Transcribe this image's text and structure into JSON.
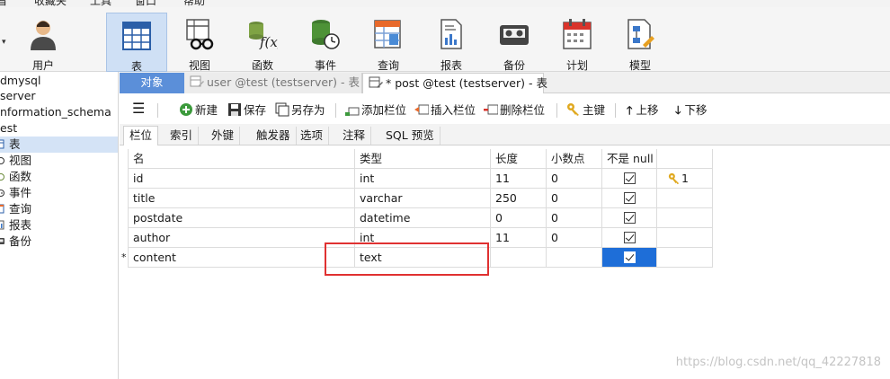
{
  "menu": [
    "看",
    "收藏夹",
    "工具",
    "窗口",
    "帮助"
  ],
  "ribbon": {
    "buttons": [
      {
        "label": "用户"
      },
      {
        "label": "表"
      },
      {
        "label": "视图"
      },
      {
        "label": "函数"
      },
      {
        "label": "事件"
      },
      {
        "label": "查询"
      },
      {
        "label": "报表"
      },
      {
        "label": "备份"
      },
      {
        "label": "计划"
      },
      {
        "label": "模型"
      }
    ],
    "active": "表"
  },
  "tree": {
    "nodes": [
      {
        "label": "dmysql"
      },
      {
        "label": "server"
      },
      {
        "label": "nformation_schema"
      },
      {
        "label": "est"
      },
      {
        "label": "表"
      },
      {
        "label": "视图"
      },
      {
        "label": "函数"
      },
      {
        "label": "事件"
      },
      {
        "label": "查询"
      },
      {
        "label": "报表"
      },
      {
        "label": "备份"
      }
    ]
  },
  "tabs": {
    "objects": "对象",
    "user_tab": "user @test (testserver) - 表",
    "post_tab": "* post @test (testserver) - 表"
  },
  "toolbar": {
    "new": "新建",
    "save": "保存",
    "save_as": "另存为",
    "add_field": "添加栏位",
    "insert_field": "插入栏位",
    "delete_field": "删除栏位",
    "primary_key": "主键",
    "move_up": "上移",
    "move_down": "下移"
  },
  "subtabs": [
    "栏位",
    "索引",
    "外键",
    "触发器",
    "选项",
    "注释",
    "SQL 预览"
  ],
  "grid": {
    "headers": {
      "name": "名",
      "type": "类型",
      "length": "长度",
      "decimals": "小数点",
      "not_null": "不是 null"
    },
    "rows": [
      {
        "indicator": "",
        "name": "id",
        "type": "int",
        "length": "11",
        "decimals": "0",
        "not_null": true,
        "key": "1"
      },
      {
        "indicator": "",
        "name": "title",
        "type": "varchar",
        "length": "250",
        "decimals": "0",
        "not_null": true,
        "key": ""
      },
      {
        "indicator": "",
        "name": "postdate",
        "type": "datetime",
        "length": "0",
        "decimals": "0",
        "not_null": true,
        "key": ""
      },
      {
        "indicator": "",
        "name": "author",
        "type": "int",
        "length": "11",
        "decimals": "0",
        "not_null": true,
        "key": ""
      },
      {
        "indicator": "*",
        "name": "content",
        "type": "text",
        "length": "",
        "decimals": "",
        "not_null": true,
        "key": ""
      }
    ]
  },
  "watermark": "https://blog.csdn.net/qq_42227818",
  "colors": {
    "accent": "#5b8fd9",
    "selection": "#1e6ed8",
    "highlight_box": "#e03131"
  }
}
